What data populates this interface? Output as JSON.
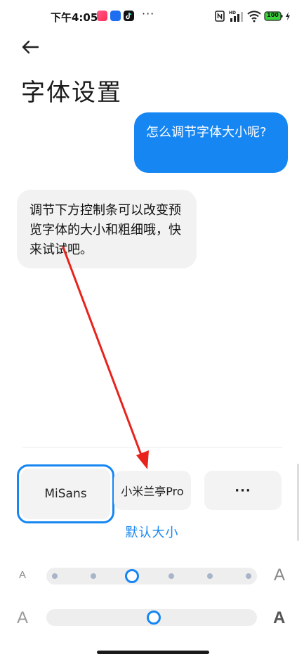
{
  "status_bar": {
    "time": "下午4:05",
    "more": "···",
    "battery": "100"
  },
  "page": {
    "title": "字体设置"
  },
  "chat": {
    "user_question": "怎么调节字体大小呢?",
    "bot_answer": "调节下方控制条可以改变预览字体的大小和粗细哦，快来试试吧。"
  },
  "fonts": {
    "selected": "MiSans",
    "options": [
      "MiSans",
      "小米兰亭Pro"
    ],
    "more_label": "···"
  },
  "default_size_label": "默认大小",
  "size_slider": {
    "min_label": "A",
    "max_label": "A",
    "steps": 6,
    "value_index": 2
  },
  "weight_slider": {
    "min_label": "A",
    "max_label": "A",
    "value_fraction": 0.51
  },
  "colors": {
    "accent": "#1686f2",
    "bubble_gray": "#f2f2f2",
    "annotation": "#e8231c"
  }
}
